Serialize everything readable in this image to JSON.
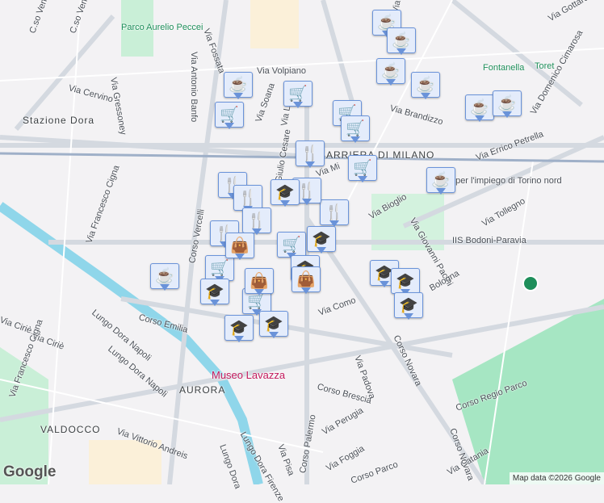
{
  "map": {
    "streets": [
      "Via Monte",
      "Via Gottardo",
      "Fontanella",
      "Toret",
      "Parco Aurelio Peccei",
      "Via Fossata",
      "Via Antonio Banfo",
      "Via Volpiano",
      "Via Gressoney",
      "Via Cervino",
      "Stazione Dora",
      "C.so Venezia",
      "C.so Venezia",
      "Via Soana",
      "Via Leinì",
      "Giulio Cesare",
      "Via Brandizzo",
      "Via Domenico Cimarosa",
      "Via Errico Petrella",
      "BARRIERA DI MILANO",
      "Via Mi",
      "Centro per l'impiego di Torino nord",
      "Via Tollegno",
      "Via Bioglio",
      "Via Giovanni Pacini",
      "IIS Bodoni-Paravia",
      "Bologna",
      "Via Francesco Cigna",
      "Corso Vercelli",
      "Lungo Dora Napoli",
      "Corso Emilia",
      "Via Como",
      "Via Ciriè",
      "Via Ciriè",
      "Via Francesco Cigna",
      "Museo Lavazza",
      "AURORA",
      "Corso Brescia",
      "Via Padova",
      "Corso Novara",
      "Corso Regio Parco",
      "VALDOCCO",
      "Via Vittorio Andreis",
      "Via Perugia",
      "Via Pisa",
      "Lungo Dora Firenze",
      "Lungo Dora",
      "Corso Palermo",
      "Via Foggia",
      "Via Catania",
      "Corso Novara",
      "Lungo Dora Napoli",
      "Corso Parco"
    ],
    "markers": [
      "cafe",
      "cafe",
      "cafe",
      "cafe",
      "cafe",
      "cafe",
      "cafe",
      "cafe",
      "cafe",
      "cart",
      "cart",
      "cart",
      "cart",
      "cart",
      "cart",
      "cart",
      "cart",
      "restaurant",
      "restaurant",
      "restaurant",
      "restaurant",
      "restaurant",
      "restaurant",
      "restaurant",
      "education",
      "education",
      "education",
      "education",
      "education",
      "education",
      "education",
      "education",
      "education",
      "shopping",
      "shopping",
      "shopping"
    ],
    "icons": {
      "cafe": "☕",
      "cart": "🛒",
      "restaurant": "🍴",
      "education": "🎓",
      "shopping": "👜"
    },
    "logo": "Google",
    "attribution": "Map data ©2026 Google"
  }
}
